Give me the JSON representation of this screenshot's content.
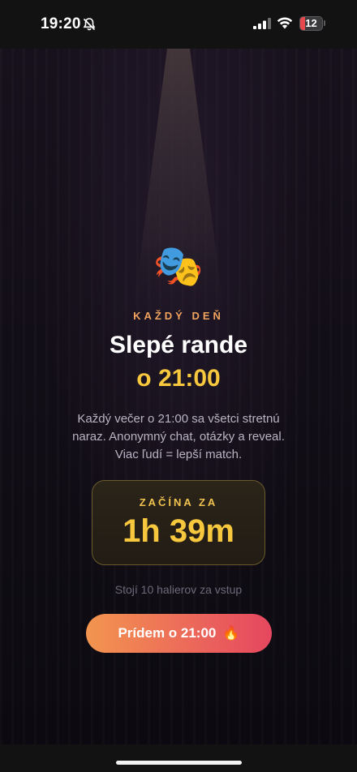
{
  "status_bar": {
    "time": "19:20",
    "battery": "12",
    "icons": [
      "bell-slash-icon",
      "cellular-signal-icon",
      "wifi-icon",
      "battery-icon"
    ]
  },
  "event": {
    "icon": "🎭",
    "eyebrow": "KAŽDÝ DEŇ",
    "title": "Slepé rande",
    "time_label": "o 21:00",
    "description": "Každý večer o 21:00 sa všetci stretnú naraz. Anonymný chat, otázky a reveal. Viac ľudí = lepší match."
  },
  "countdown": {
    "label": "ZAČÍNA ZA",
    "value": "1h 39m"
  },
  "cost_note": "Stojí 10 halierov za vstup",
  "cta": {
    "label": "Prídem o 21:00",
    "emoji": "🔥"
  },
  "colors": {
    "accent_orange": "#f0a35c",
    "accent_yellow": "#f7c83e",
    "cta_gradient_start": "#f3954f",
    "cta_gradient_end": "#e5475f",
    "background": "#0b0a0e"
  }
}
